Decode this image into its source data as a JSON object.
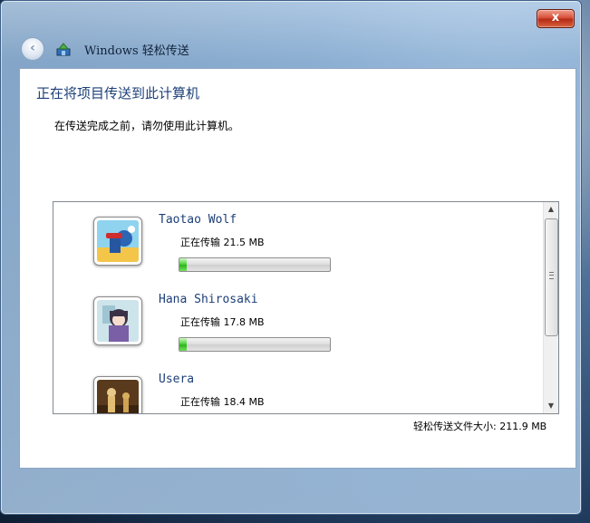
{
  "window": {
    "title": "Windows 轻松传送",
    "close_label": "x",
    "back_label": "‹"
  },
  "page": {
    "heading": "正在将项目传送到此计算机",
    "subtext": "在传送完成之前，请勿使用此计算机。"
  },
  "users": [
    {
      "name": "Taotao Wolf",
      "status": "正在传输 21.5 MB",
      "progress": 0.05
    },
    {
      "name": "Hana Shirosaki",
      "status": "正在传输 17.8 MB",
      "progress": 0.05
    },
    {
      "name": "Usera",
      "status": "正在传输 18.4 MB",
      "progress": 0.05
    }
  ],
  "footer": {
    "total_label": "轻松传送文件大小: 211.9 MB"
  },
  "colors": {
    "heading": "#1d3f78",
    "progress_green": "#2cb61b",
    "close_red": "#c43b25"
  },
  "icons": {
    "back": "back-arrow-icon",
    "app": "easy-transfer-icon",
    "close": "close-icon"
  }
}
